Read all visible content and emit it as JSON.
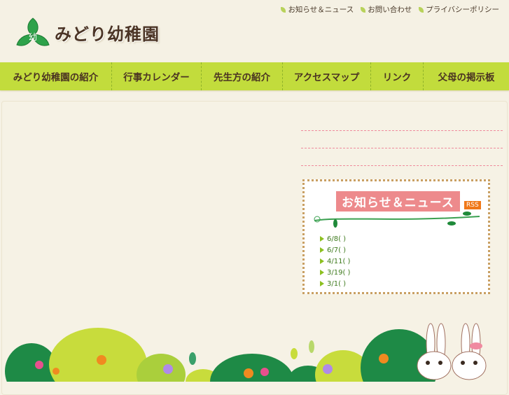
{
  "header": {
    "logo_text": "みどり幼稚園",
    "logo_mark": "幼",
    "util_links": [
      "お知らせ＆ニュース",
      "お問い合わせ",
      "プライバシーポリシー"
    ]
  },
  "nav": {
    "items": [
      "みどり幼稚園の紹介",
      "行事カレンダー",
      "先生方の紹介",
      "アクセスマップ",
      "リンク",
      "父母の掲示板"
    ]
  },
  "news": {
    "title": "お知らせ＆ニュース",
    "rss_label": "RSS",
    "items": [
      "6/8( )",
      "6/7( )",
      "4/11( )",
      "3/19( )",
      "3/1( )"
    ]
  },
  "colors": {
    "nav": "#c2dc3c",
    "accent_pink": "#ed8a8c",
    "rss": "#f07818",
    "brown": "#4b3425"
  }
}
